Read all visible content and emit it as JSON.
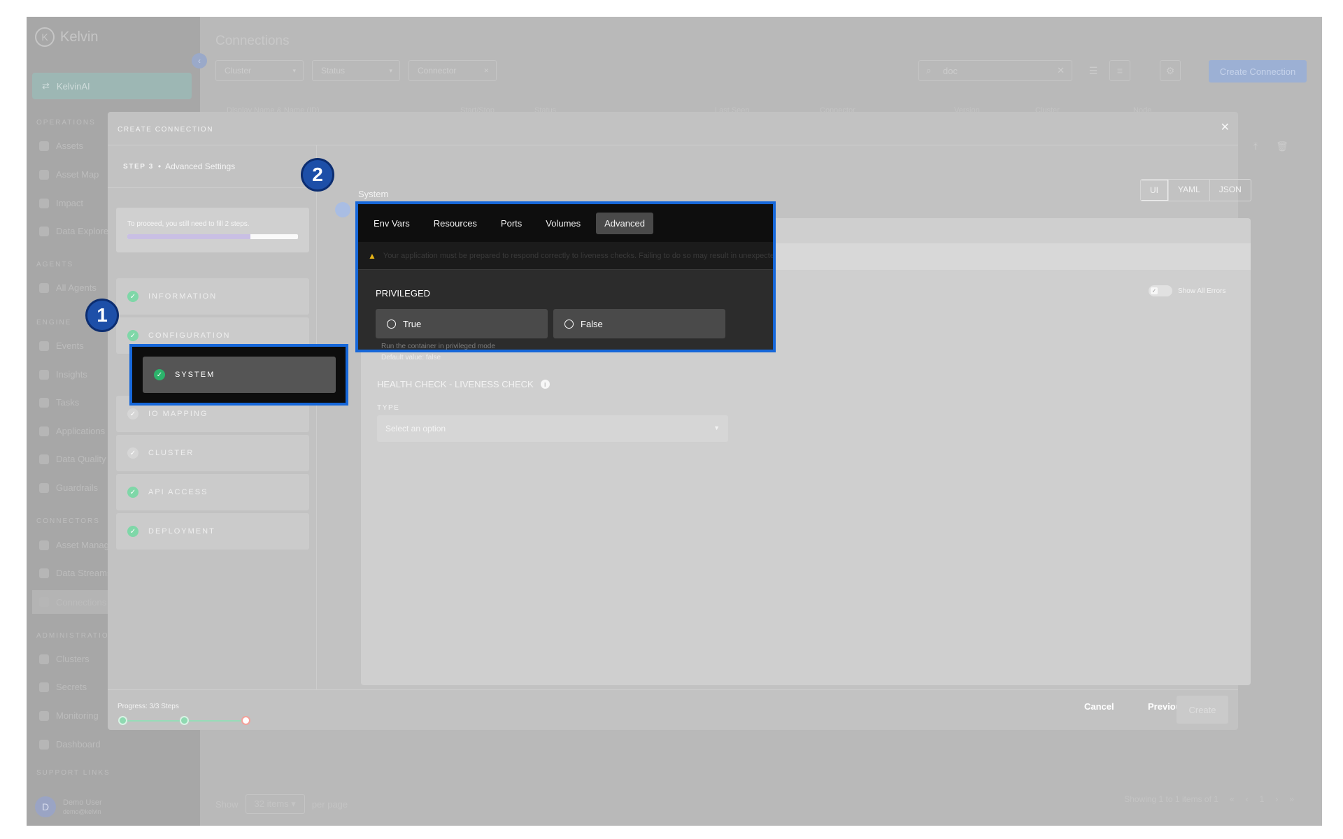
{
  "app": {
    "brand": "Kelvin",
    "brand_logo_letter": "K",
    "workspace": "KelvinAI",
    "page_title": "Connections"
  },
  "sidebar": {
    "sections": [
      {
        "label": "OPERATIONS",
        "items": [
          "Assets",
          "Asset Map",
          "Impact",
          "Data Explorer"
        ]
      },
      {
        "label": "AGENTS",
        "items": [
          "All Agents"
        ]
      },
      {
        "label": "ENGINE",
        "items": [
          "Events",
          "Insights",
          "Tasks",
          "Applications",
          "Data Quality",
          "Guardrails"
        ]
      },
      {
        "label": "CONNECTORS",
        "items": [
          "Asset Manager",
          "Data Streams",
          "Connections"
        ]
      },
      {
        "label": "ADMINISTRATION",
        "items": [
          "Clusters",
          "Secrets",
          "Monitoring",
          "Dashboard"
        ]
      },
      {
        "label": "SUPPORT LINKS",
        "items": []
      }
    ],
    "user": {
      "initial": "D",
      "name": "Demo User",
      "role": "demo@kelvin"
    }
  },
  "toolbar": {
    "filters": [
      "Cluster",
      "Status",
      "Connector"
    ],
    "search_value": "doc",
    "create_button": "Create Connection"
  },
  "table": {
    "columns": [
      "Display Name & Name (ID)",
      "Start/Stop",
      "Status",
      "Last Seen",
      "Connector",
      "Version",
      "Cluster",
      "Node"
    ]
  },
  "pagination": {
    "show_label": "Show",
    "per_page_value": "32 items",
    "per_page_label": "per page",
    "summary": "Showing 1 to 1 items of 1",
    "current_page": "1"
  },
  "modal": {
    "title": "CREATE CONNECTION",
    "step_number": "STEP 3",
    "step_name": "Advanced Settings",
    "progress_card": {
      "text": "To proceed, you still need to fill 2 steps.",
      "fill_fraction": 0.72
    },
    "steps": [
      {
        "label": "INFORMATION",
        "done": true
      },
      {
        "label": "CONFIGURATION",
        "done": true
      },
      {
        "label": "SYSTEM",
        "done": true,
        "selected": true
      },
      {
        "label": "IO MAPPING",
        "done": false
      },
      {
        "label": "CLUSTER",
        "done": false
      },
      {
        "label": "API ACCESS",
        "done": true
      },
      {
        "label": "DEPLOYMENT",
        "done": true
      }
    ],
    "section_title": "System",
    "view_modes": [
      "UI",
      "YAML",
      "JSON"
    ],
    "active_view": "UI",
    "tabs": [
      "Env Vars",
      "Resources",
      "Ports",
      "Volumes",
      "Advanced"
    ],
    "active_tab": "Advanced",
    "warning": "Your application must be prepared to respond correctly to liveness checks. Failing to do so may result in unexpected restarts and downtime of your application.",
    "show_all_errors": "Show All Errors",
    "privileged": {
      "title": "PRIVILEGED",
      "options": [
        "True",
        "False"
      ],
      "description": "Run the container in privileged mode",
      "default_text": "Default value: false"
    },
    "health_check": {
      "title": "HEALTH CHECK - LIVENESS CHECK",
      "type_label": "TYPE",
      "type_placeholder": "Select an option"
    },
    "footer": {
      "progress_label": "Progress: 3/3 Steps",
      "cancel": "Cancel",
      "previous": "Previous",
      "create": "Create"
    }
  },
  "callouts": {
    "first": "1",
    "second": "2"
  },
  "colors": {
    "callout_border": "#1667d9",
    "badge": "#1d4fa8",
    "success": "#2cb36b",
    "warning": "#e7b416"
  }
}
